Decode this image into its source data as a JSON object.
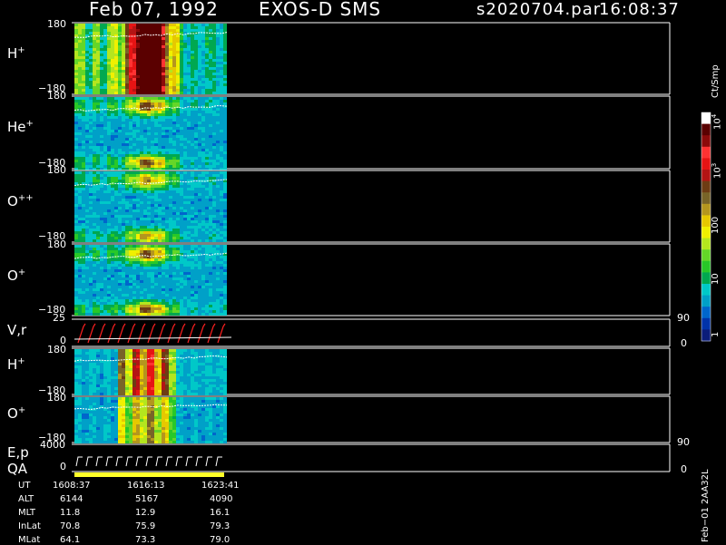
{
  "header": {
    "date": "Feb 07, 1992",
    "instrument": "EXOS-D SMS",
    "file": "s2020704.par",
    "time": "16:08:37"
  },
  "colorbar": {
    "unit_label": "Ct/Smp",
    "ticks": [
      "1",
      "10",
      "100",
      "10",
      "10",
      ""
    ],
    "tick_text": {
      "t1": "1",
      "t10": "10",
      "t100": "100",
      "t1e3": "10",
      "t1e3_exp": "3",
      "t1e4": "10",
      "t1e4_exp": "4"
    },
    "colors": [
      "#0b1d7a",
      "#0033aa",
      "#0066cc",
      "#00a0c8",
      "#00c8c8",
      "#00a850",
      "#28c828",
      "#64d628",
      "#b4e61e",
      "#f0f000",
      "#e6c800",
      "#b4961e",
      "#786428",
      "#6e3c14",
      "#b41414",
      "#e61414",
      "#ff3232",
      "#8c0a0a",
      "#5a0000",
      "#ffffff"
    ]
  },
  "panels": [
    {
      "id": "h_plus",
      "label_main": "H",
      "label_sup": "+",
      "ytop": "180",
      "ybot": "−180"
    },
    {
      "id": "he_plus",
      "label_main": "He",
      "label_sup": "+",
      "ytop": "180",
      "ybot": "−180"
    },
    {
      "id": "o_plusplus",
      "label_main": "O",
      "label_sup": "++",
      "ytop": "180",
      "ybot": "−180"
    },
    {
      "id": "o_plus",
      "label_main": "O",
      "label_sup": "+",
      "ytop": "180",
      "ybot": "−180"
    },
    {
      "id": "vr",
      "label_main": "V,r",
      "label_sup": "",
      "ytop": "25",
      "ybot": "0",
      "right_top": "90",
      "right_bot": "0"
    },
    {
      "id": "h_plus_2",
      "label_main": "H",
      "label_sup": "+",
      "ytop": "180",
      "ybot": "−180"
    },
    {
      "id": "o_plus_2",
      "label_main": "O",
      "label_sup": "+",
      "ytop": "180",
      "ybot": "−180"
    },
    {
      "id": "ep",
      "label_main": "E,p",
      "label_sup": "",
      "ytop": "4000",
      "ybot": "0",
      "right_top": "90",
      "right_bot": "0"
    }
  ],
  "qa_label": "QA",
  "side_label": "Feb−01 2AA32L",
  "time_table": {
    "rows": [
      {
        "name": "UT",
        "values": [
          "1608:37",
          "1616:13",
          "1623:41"
        ]
      },
      {
        "name": "ALT",
        "values": [
          "6144",
          "5167",
          "4090"
        ]
      },
      {
        "name": "MLT",
        "values": [
          "11.8",
          "12.9",
          "16.1"
        ]
      },
      {
        "name": "InLat",
        "values": [
          "70.8",
          "75.9",
          "79.3"
        ]
      },
      {
        "name": "MLat",
        "values": [
          "64.1",
          "73.3",
          "79.0"
        ]
      }
    ]
  },
  "chart_data": {
    "type": "heatmap",
    "title": "Feb 07, 1992   EXOS-D SMS   s2020704.par  16:08:37",
    "xlabel": "UT",
    "x_ticks": [
      "1608:37",
      "1616:13",
      "1623:41"
    ],
    "series": [
      {
        "name": "H+",
        "ylim": [
          -180,
          180
        ]
      },
      {
        "name": "He+",
        "ylim": [
          -180,
          180
        ]
      },
      {
        "name": "O++",
        "ylim": [
          -180,
          180
        ]
      },
      {
        "name": "O+",
        "ylim": [
          -180,
          180
        ]
      },
      {
        "name": "V,r",
        "ylim": [
          0,
          25
        ],
        "y2lim": [
          0,
          90
        ]
      },
      {
        "name": "H+",
        "ylim": [
          -180,
          180
        ]
      },
      {
        "name": "O+",
        "ylim": [
          -180,
          180
        ]
      },
      {
        "name": "E,p",
        "ylim": [
          0,
          4000
        ],
        "y2lim": [
          0,
          90
        ]
      }
    ],
    "colorbar_unit": "Ct/Smp",
    "colorbar_range": [
      1,
      10000
    ],
    "colorbar_scale": "log"
  }
}
